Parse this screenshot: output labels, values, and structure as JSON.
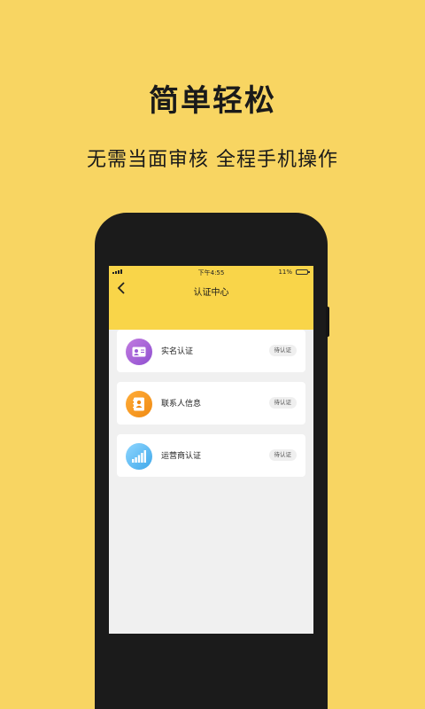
{
  "headline": "简单轻松",
  "subline": "无需当面审核  全程手机操作",
  "status_bar": {
    "time": "下午4:55",
    "battery_text": "11%"
  },
  "nav": {
    "title": "认证中心"
  },
  "items": [
    {
      "label": "实名认证",
      "status": "待认证",
      "icon": "id-card-icon"
    },
    {
      "label": "联系人信息",
      "status": "待认证",
      "icon": "contact-book-icon"
    },
    {
      "label": "运营商认证",
      "status": "待认证",
      "icon": "signal-bars-icon"
    }
  ],
  "colors": {
    "background": "#f8d562",
    "header": "#f9d549",
    "purple": "#a866da",
    "orange": "#f89a22",
    "blue": "#5bbcf2"
  }
}
